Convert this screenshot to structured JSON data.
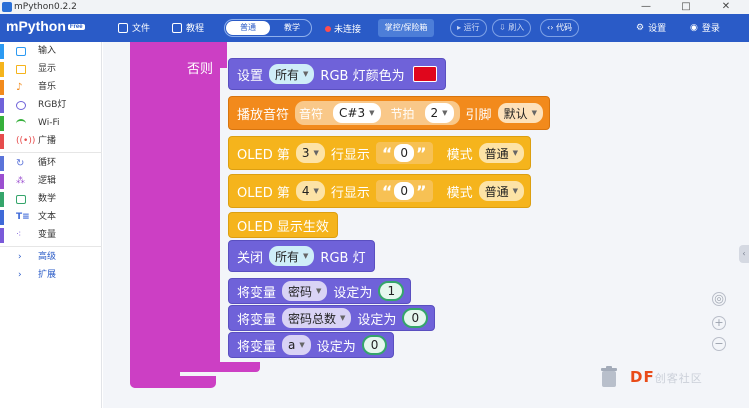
{
  "window": {
    "title": "mPython0.2.2",
    "controls": {
      "minimize": "—",
      "maximize": "□",
      "close": "✕"
    }
  },
  "toolbar": {
    "brand": "mPython",
    "brand_badge": "Free",
    "file_label": "文件",
    "tutorial_label": "教程",
    "mode_normal": "普通",
    "mode_teach": "教学",
    "status_label": "未连接",
    "device_label": "掌控/保险箱",
    "run_label": "运行",
    "flash_label": "刷入",
    "code_label": "代码",
    "settings_label": "设置",
    "login_label": "登录"
  },
  "sidebar": {
    "items": [
      {
        "label": "输入",
        "color": "#2c9af2",
        "icon": "input-icon"
      },
      {
        "label": "显示",
        "color": "#f5b41c",
        "icon": "display-icon"
      },
      {
        "label": "音乐",
        "color": "#f28a1c",
        "icon": "music-icon"
      },
      {
        "label": "RGB灯",
        "color": "#6f62d9",
        "icon": "bulb-icon"
      },
      {
        "label": "Wi-Fi",
        "color": "#36b03b",
        "icon": "wifi-icon"
      },
      {
        "label": "广播",
        "color": "#e64c4c",
        "icon": "broadcast-icon"
      },
      {
        "label": "循环",
        "color": "#5b73d9",
        "icon": "loop-icon"
      },
      {
        "label": "逻辑",
        "color": "#9b4fd0",
        "icon": "logic-icon"
      },
      {
        "label": "数学",
        "color": "#35a56b",
        "icon": "math-icon"
      },
      {
        "label": "文本",
        "color": "#3f6ad8",
        "icon": "text-icon"
      },
      {
        "label": "变量",
        "color": "#7a5ad9",
        "icon": "variable-icon"
      }
    ],
    "advanced_label": "高级",
    "extend_label": "扩展"
  },
  "workspace": {
    "else_label": "否则",
    "blocks": {
      "rgb_set": {
        "prefix": "设置",
        "target": "所有",
        "suffix": "RGB 灯颜色为",
        "color": "#e0061c"
      },
      "play_note": {
        "prefix": "播放音符",
        "note_label": "音符",
        "note": "C#3",
        "beat_label": "节拍",
        "beat": "2",
        "pin_label": "引脚",
        "pin": "默认"
      },
      "oled_line3": {
        "prefix": "OLED 第",
        "line": "3",
        "mid": "行显示",
        "text": "0",
        "mode_label": "模式",
        "mode": "普通"
      },
      "oled_line4": {
        "prefix": "OLED 第",
        "line": "4",
        "mid": "行显示",
        "text": "0",
        "mode_label": "模式",
        "mode": "普通"
      },
      "oled_show": {
        "label": "OLED 显示生效"
      },
      "rgb_off": {
        "prefix": "关闭",
        "target": "所有",
        "suffix": "RGB 灯"
      },
      "var1": {
        "prefix": "将变量",
        "name": "密码",
        "mid": "设定为",
        "value": "1"
      },
      "var2": {
        "prefix": "将变量",
        "name": "密码总数",
        "mid": "设定为",
        "value": "0"
      },
      "var3": {
        "prefix": "将变量",
        "name": "a",
        "mid": "设定为",
        "value": "0"
      }
    }
  },
  "watermark": {
    "df": "DF",
    "rest": "创客社区"
  }
}
